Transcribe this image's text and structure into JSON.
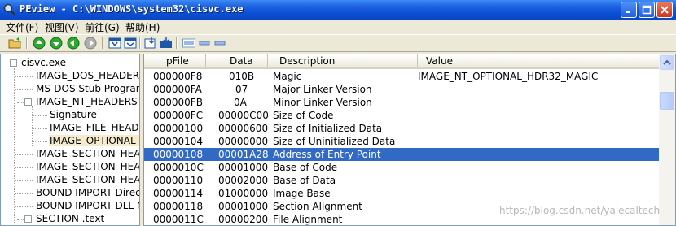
{
  "window": {
    "title": "PEview - C:\\WINDOWS\\system32\\cisvc.exe"
  },
  "menu": {
    "items": [
      "文件(F)",
      "视图(V)",
      "前往(G)",
      "帮助(H)"
    ]
  },
  "toolbar": {
    "buttons": [
      "open-folder-icon",
      "go-first-icon",
      "go-back-icon",
      "go-forward-icon",
      "go-last-icon",
      "view-byte-icon",
      "view-word-icon",
      "view-dword-icon",
      "view-qword-icon",
      "address-icon",
      "list-icon",
      "detail-icon"
    ]
  },
  "tree": {
    "items": [
      {
        "label": "cisvc.exe"
      },
      {
        "label": "IMAGE_DOS_HEADER"
      },
      {
        "label": "MS-DOS Stub Program"
      },
      {
        "label": "IMAGE_NT_HEADERS"
      },
      {
        "label": "Signature"
      },
      {
        "label": "IMAGE_FILE_HEADER"
      },
      {
        "label": "IMAGE_OPTIONAL_HEADER"
      },
      {
        "label": "IMAGE_SECTION_HEADER .text"
      },
      {
        "label": "IMAGE_SECTION_HEADER .data"
      },
      {
        "label": "IMAGE_SECTION_HEADER .rsrc"
      },
      {
        "label": "BOUND IMPORT Directory Table"
      },
      {
        "label": "BOUND IMPORT DLL Names"
      },
      {
        "label": "SECTION .text"
      }
    ]
  },
  "table": {
    "columns": [
      "pFile",
      "Data",
      "Description",
      "Value"
    ],
    "rows": [
      {
        "pfile": "000000F8",
        "data": "010B",
        "description": "Magic",
        "value": "IMAGE_NT_OPTIONAL_HDR32_MAGIC"
      },
      {
        "pfile": "000000FA",
        "data": "07",
        "description": "Major Linker Version",
        "value": ""
      },
      {
        "pfile": "000000FB",
        "data": "0A",
        "description": "Minor Linker Version",
        "value": ""
      },
      {
        "pfile": "000000FC",
        "data": "00000C00",
        "description": "Size of Code",
        "value": ""
      },
      {
        "pfile": "00000100",
        "data": "00000600",
        "description": "Size of Initialized Data",
        "value": ""
      },
      {
        "pfile": "00000104",
        "data": "00000000",
        "description": "Size of Uninitialized Data",
        "value": ""
      },
      {
        "pfile": "00000108",
        "data": "00001A28",
        "description": "Address of Entry Point",
        "value": ""
      },
      {
        "pfile": "0000010C",
        "data": "00001000",
        "description": "Base of Code",
        "value": ""
      },
      {
        "pfile": "00000110",
        "data": "00002000",
        "description": "Base of Data",
        "value": ""
      },
      {
        "pfile": "00000114",
        "data": "01000000",
        "description": "Image Base",
        "value": ""
      },
      {
        "pfile": "00000118",
        "data": "00001000",
        "description": "Section Alignment",
        "value": ""
      },
      {
        "pfile": "0000011C",
        "data": "00000200",
        "description": "File Alignment",
        "value": ""
      }
    ],
    "selected_row": 6
  },
  "watermark": "https://blog.csdn.net/yalecaltech",
  "colors": {
    "selection": "#316ac5",
    "titlebar": "#0a4fd4",
    "tree_selection": "#f6eccc"
  }
}
